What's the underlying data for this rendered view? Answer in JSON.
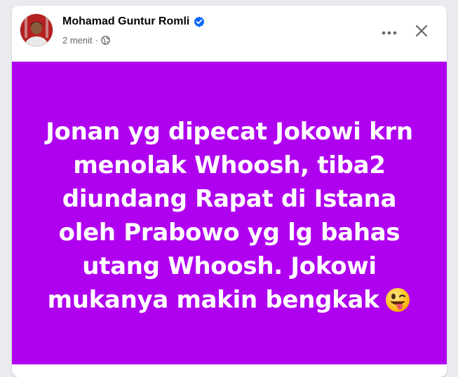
{
  "post": {
    "author": {
      "name": "Mohamad Guntur Romli",
      "verified": true
    },
    "meta": {
      "time": "2 menit",
      "separator": "·",
      "privacy_icon": "globe-icon"
    },
    "actions": {
      "more_icon": "more-options-icon",
      "close_icon": "close-icon"
    },
    "content": {
      "background_color": "#b000f0",
      "text_color": "#ffffff",
      "text": "Jonan yg dipecat Jokowi krn menolak Whoosh, tiba2 diundang Rapat di Istana oleh Prabowo yg lg bahas utang Whoosh. Jokowi mukanya makin bengkak",
      "emoji": "winking-face-with-tongue-emoji"
    }
  },
  "colors": {
    "verified_badge": "#0866ff",
    "secondary_text": "#65676b",
    "primary_text": "#050505"
  }
}
